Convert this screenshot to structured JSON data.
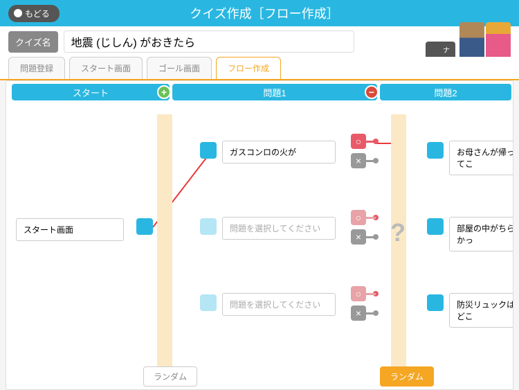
{
  "header": {
    "back": "もどる",
    "title": "クイズ作成［フロー作成］"
  },
  "quiz": {
    "name_label": "クイズ名",
    "name_value": "地震 (じしん) がおきたら",
    "navigator_change": "ナビゲーター変更"
  },
  "tabs": [
    {
      "label": "問題登録",
      "active": false
    },
    {
      "label": "スタート画面",
      "active": false
    },
    {
      "label": "ゴール画面",
      "active": false
    },
    {
      "label": "フロー作成",
      "active": true
    }
  ],
  "flow": {
    "columns": [
      {
        "title": "スタート"
      },
      {
        "title": "問題1"
      },
      {
        "title": "問題2"
      }
    ],
    "random_label": "ランダム",
    "question_mark": "?",
    "start_node": "スタート画面",
    "placeholder": "問題を選択してください",
    "q1": {
      "items": [
        "ガスコンロの火が",
        "問題を選択してください",
        "問題を選択してください"
      ]
    },
    "q2": {
      "items": [
        "お母さんが帰ってこ",
        "部屋の中がちらかっ",
        "防災リュックはどこ"
      ]
    },
    "answer_correct_glyph": "○",
    "answer_wrong_glyph": "×"
  }
}
